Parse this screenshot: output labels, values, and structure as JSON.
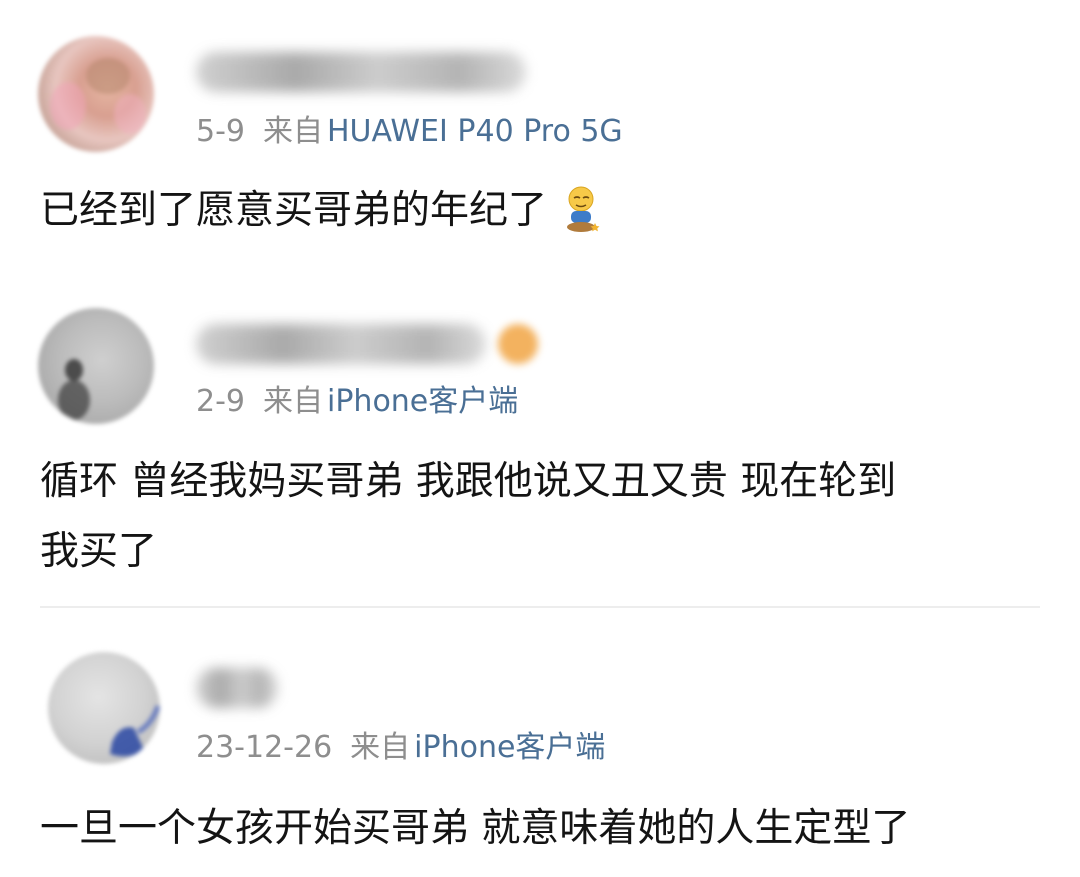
{
  "comments": [
    {
      "date": "5-9",
      "from_label": "来自",
      "device": "HUAWEI P40 Pro 5G",
      "text_lines": [
        "已经到了愿意买哥弟的年纪了"
      ]
    },
    {
      "date": "2-9",
      "from_label": "来自",
      "device": "iPhone客户端",
      "text_lines": [
        "循环 曾经我妈买哥弟 我跟他说又丑又贵 现在轮到",
        "我买了"
      ]
    },
    {
      "date": "23-12-26",
      "from_label": "来自",
      "device": "iPhone客户端",
      "text_lines": [
        "一旦一个女孩开始买哥弟 就意味着她的人生定型了"
      ]
    }
  ],
  "colors": {
    "meta_text": "#8e8e8e",
    "device_link": "#4a6f95",
    "body_text": "#141414",
    "divider": "#ededed"
  },
  "icons": [
    "emoji-sitting-face-icon",
    "vip-badge-icon"
  ]
}
